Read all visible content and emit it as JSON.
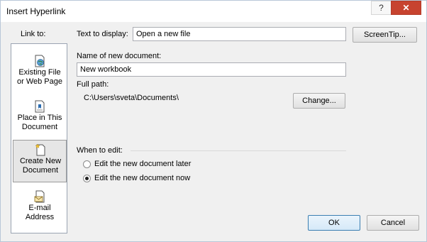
{
  "window": {
    "title": "Insert Hyperlink",
    "help_label": "?",
    "close_label": "✕"
  },
  "sidebar": {
    "link_to_label": "Link to:",
    "items": [
      {
        "label": "Existing File\nor Web Page",
        "icon": "globe-file-icon",
        "selected": false
      },
      {
        "label": "Place in This\nDocument",
        "icon": "document-bookmark-icon",
        "selected": false
      },
      {
        "label": "Create New\nDocument",
        "icon": "new-document-icon",
        "selected": true
      },
      {
        "label": "E-mail\nAddress",
        "icon": "email-icon",
        "selected": false
      }
    ]
  },
  "main": {
    "text_to_display_label": "Text to display:",
    "text_to_display_value": "Open a new file",
    "screentip_label": "ScreenTip...",
    "name_label": "Name of new document:",
    "name_value": "New workbook",
    "full_path_label": "Full path:",
    "full_path_value": "C:\\Users\\sveta\\Documents\\",
    "change_label": "Change...",
    "when_to_edit_label": "When to edit:",
    "options": [
      {
        "label": "Edit the new document later",
        "selected": false
      },
      {
        "label": "Edit the new document now",
        "selected": true
      }
    ]
  },
  "footer": {
    "ok_label": "OK",
    "cancel_label": "Cancel"
  },
  "colors": {
    "close_button": "#c7432f",
    "default_button_border": "#3c7fb1",
    "selected_item_bg": "#e6e6e6"
  }
}
